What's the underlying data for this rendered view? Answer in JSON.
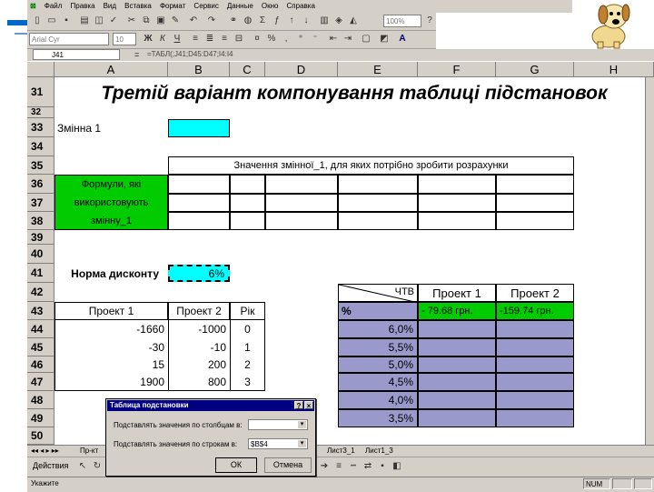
{
  "menu": [
    "Файл",
    "Правка",
    "Вид",
    "Вставка",
    "Формат",
    "Сервис",
    "Данные",
    "Окно",
    "Справка"
  ],
  "toolbar": {
    "font": "Arial Cyr",
    "size": "10",
    "zoom": "100%"
  },
  "formula_bar": {
    "name_box": "J41",
    "formula": "=ТАБЛ(;J41;D45:D47;I4:I4"
  },
  "columns": [
    "A",
    "B",
    "C",
    "D",
    "E",
    "F",
    "G",
    "H"
  ],
  "rows": [
    "31",
    "32",
    "33",
    "34",
    "35",
    "36",
    "37",
    "38",
    "39",
    "40",
    "41",
    "42",
    "43",
    "44",
    "45",
    "46",
    "47",
    "48",
    "49",
    "50"
  ],
  "title": "Третій варіант компонування таблиці підстановок",
  "variable_label": "Змінна 1",
  "values_header": "Значення змінної_1, для яких потрібно зробити розрахунки",
  "formulas_label": [
    "Формули, які",
    "використовують",
    "змінну_1"
  ],
  "discount_label": "Норма дисконту",
  "discount_value": "6%",
  "projects_header": [
    "Проект 1",
    "Проект 2",
    "Рік"
  ],
  "projects": [
    [
      "-1660",
      "-1000",
      "0"
    ],
    [
      "-30",
      "-10",
      "1"
    ],
    [
      "15",
      "200",
      "2"
    ],
    [
      "1900",
      "800",
      "3"
    ]
  ],
  "npv_header": {
    "corner_top": "ЧТВ",
    "corner_bottom": "%",
    "p1": "Проект 1",
    "p2": "Проект 2"
  },
  "npv_row": {
    "p1": "-  79.68 грн.",
    "p2": "-159.74 грн."
  },
  "rates": [
    "6,0%",
    "5,5%",
    "5,0%",
    "4,5%",
    "4,0%",
    "3,5%"
  ],
  "dialog": {
    "title": "Таблица подстановки",
    "help": "?",
    "close": "×",
    "col_label": "Подставлять значения по столбцам в:",
    "row_label": "Подставлять значения по строкам в:",
    "row_value": "$B$4",
    "ok": "ОК",
    "cancel": "Отмена"
  },
  "sheet_tabs": [
    "Пр-кт",
    "Лист3_1",
    "Лист1_3"
  ],
  "draw_label": "Действия",
  "status": {
    "ready": "Укажите",
    "num": "NUM"
  }
}
